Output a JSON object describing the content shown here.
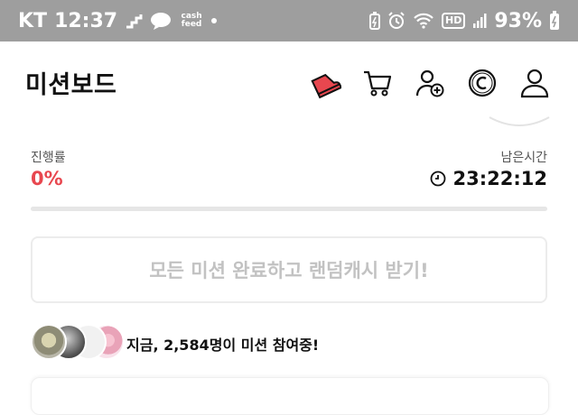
{
  "status_bar": {
    "carrier": "KT",
    "time": "12:37",
    "app_badge": "cash feed",
    "battery": "93%",
    "hd_label": "HD"
  },
  "header": {
    "title": "미션보드",
    "icons": [
      "shoe-icon",
      "cart-icon",
      "add-friend-icon",
      "coin-icon",
      "profile-icon"
    ]
  },
  "progress": {
    "label": "진행률",
    "value_text": "0%",
    "fraction": 0
  },
  "remaining": {
    "label": "남은시간",
    "time": "23:22:12"
  },
  "reward_button": {
    "label": "모든 미션 완료하고 랜덤캐시 받기!"
  },
  "participants": {
    "prefix": "지금, ",
    "count": "2,584명",
    "suffix": "이 미션 참여중!"
  },
  "colors": {
    "accent": "#e8474f",
    "status_bar_bg": "#9e9e9e",
    "disabled_text": "#c2c2c2"
  }
}
